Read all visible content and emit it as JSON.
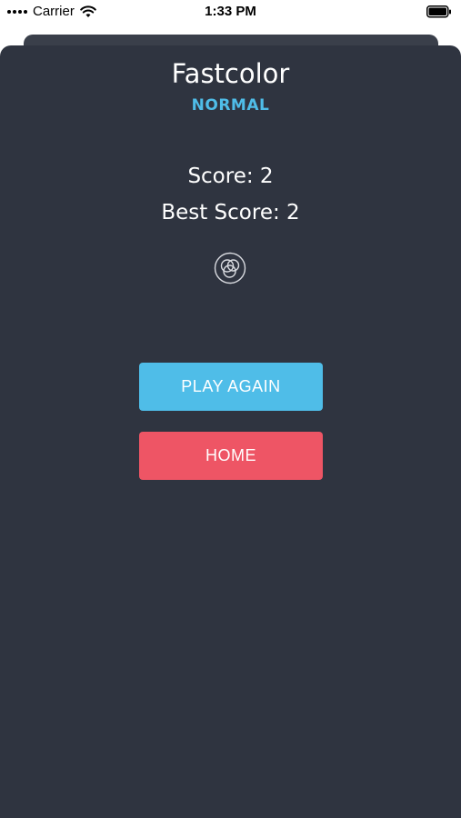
{
  "status_bar": {
    "carrier": "Carrier",
    "time": "1:33 PM"
  },
  "game": {
    "title": "Fastcolor",
    "mode": "NORMAL",
    "score_text": "Score: 2",
    "best_score_text": "Best Score: 2"
  },
  "buttons": {
    "play_again": "PLAY AGAIN",
    "home": "HOME"
  },
  "colors": {
    "background": "#2f3440",
    "accent_blue": "#4fbde8",
    "accent_red": "#ee5565"
  },
  "icons": {
    "logo": "overlapping-circles-icon"
  }
}
